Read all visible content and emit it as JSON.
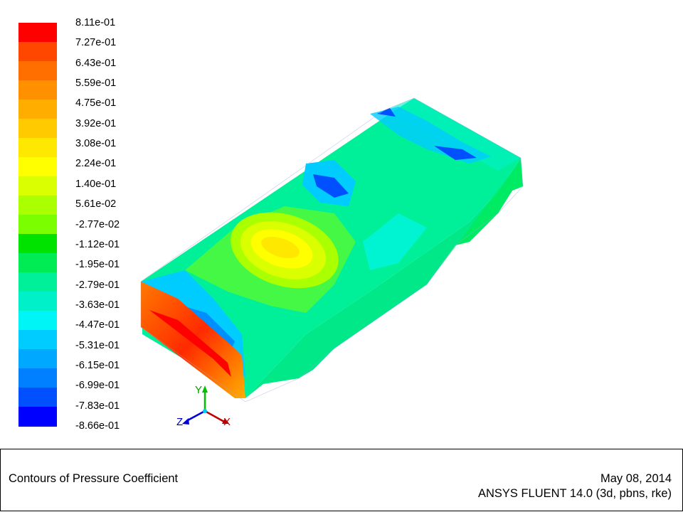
{
  "legend": {
    "ticks": [
      "8.11e-01",
      "7.27e-01",
      "6.43e-01",
      "5.59e-01",
      "4.75e-01",
      "3.92e-01",
      "3.08e-01",
      "2.24e-01",
      "1.40e-01",
      "5.61e-02",
      "-2.77e-02",
      "-1.12e-01",
      "-1.95e-01",
      "-2.79e-01",
      "-3.63e-01",
      "-4.47e-01",
      "-5.31e-01",
      "-6.15e-01",
      "-6.99e-01",
      "-7.83e-01",
      "-8.66e-01"
    ],
    "colors": [
      "#ff0000",
      "#ff4700",
      "#ff6f00",
      "#ff9000",
      "#ffae00",
      "#ffcb00",
      "#ffe800",
      "#ffff00",
      "#d9ff00",
      "#aaff00",
      "#7bff00",
      "#00e300",
      "#00ec55",
      "#00f09a",
      "#00f0c9",
      "#00f6f6",
      "#00ccff",
      "#00a8ff",
      "#0080ff",
      "#0050ff",
      "#0000ff"
    ]
  },
  "axes": {
    "y": "Y",
    "z": "Z",
    "x": "X"
  },
  "info": {
    "title": "Contours of Pressure Coefficient",
    "date": "May 08, 2014",
    "version": "ANSYS FLUENT 14.0 (3d, pbns, rke)"
  }
}
